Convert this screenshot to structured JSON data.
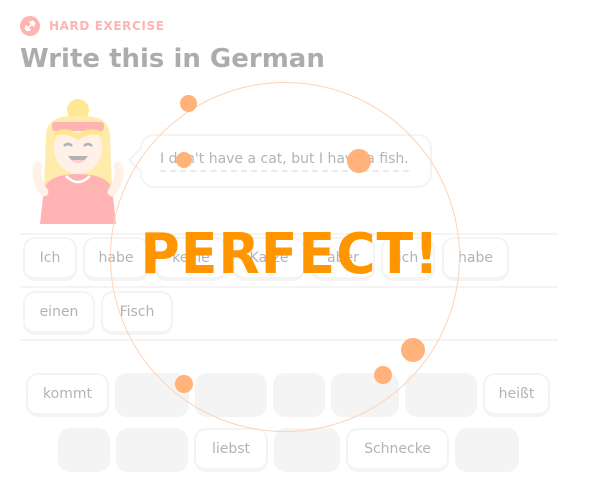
{
  "exercise": {
    "badge_label": "HARD EXERCISE",
    "badge_icon": "dumbbell-icon",
    "title": "Write this in German",
    "prompt": "I don't have a cat, but I have a fish."
  },
  "answer_tiles_row1": [
    "Ich",
    "habe",
    "keine",
    "Katze",
    "aber",
    "ich",
    "habe"
  ],
  "answer_tiles_row2": [
    "einen",
    "Fisch"
  ],
  "bank_row1": [
    "kommt",
    "",
    "",
    "",
    "",
    "",
    "heißt"
  ],
  "bank_row2": [
    "",
    "",
    "liebst",
    "",
    "Schnecke",
    ""
  ],
  "feedback": {
    "text": "PERFECT!"
  },
  "colors": {
    "badge": "#ff4b4b",
    "feedback": "#ff9600",
    "confetti": "#ffb27a",
    "tile_border": "#e5e5e5"
  }
}
